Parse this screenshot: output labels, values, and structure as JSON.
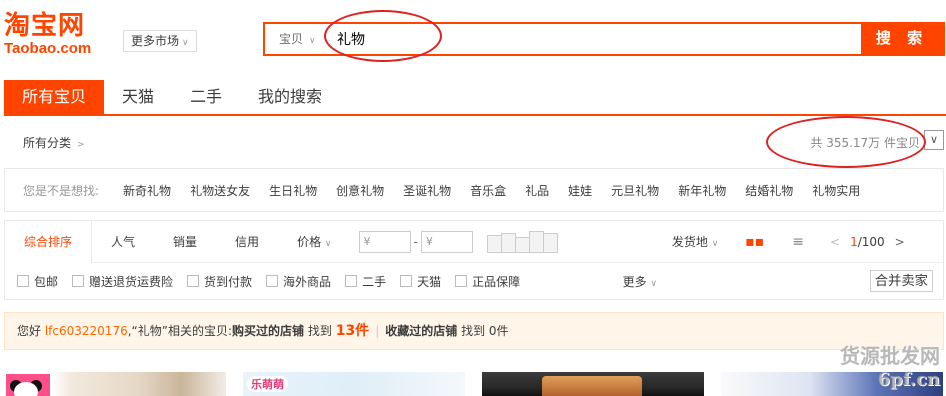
{
  "logo": {
    "cn": "淘宝网",
    "en": "Taobao.com"
  },
  "market_button": "更多市场",
  "search": {
    "type_label": "宝贝",
    "query": "礼物",
    "button": "搜 索"
  },
  "tabs": [
    "所有宝贝",
    "天猫",
    "二手",
    "我的搜索"
  ],
  "category": {
    "label": "所有分类",
    "count_text": "共 355.17万 件宝贝"
  },
  "suggest": {
    "label": "您是不是想找:",
    "items": [
      "新奇礼物",
      "礼物送女友",
      "生日礼物",
      "创意礼物",
      "圣诞礼物",
      "音乐盒",
      "礼品",
      "娃娃",
      "元旦礼物",
      "新年礼物",
      "结婚礼物",
      "礼物实用"
    ]
  },
  "sort": {
    "items": [
      "综合排序",
      "人气",
      "销量",
      "信用",
      "价格"
    ],
    "price_min_placeholder": "¥",
    "price_max_placeholder": "¥",
    "price_sep": "-",
    "location": "发货地",
    "page_current": "1",
    "page_total": "/100"
  },
  "checks": [
    "包邮",
    "赠送退货运费险",
    "货到付款",
    "海外商品",
    "二手",
    "天猫",
    "正品保障"
  ],
  "more_label": "更多",
  "merge_button": "合并卖家",
  "notice": {
    "greet": "您好",
    "user": "lfc603220176",
    "query_part": ",“礼物”相关的宝贝:",
    "bought_label": "购买过的店铺",
    "found1": "找到",
    "bought_count": "13件",
    "fav_label": "收藏过的店铺",
    "found2": "找到",
    "fav_count": "0件"
  },
  "thumbs": {
    "brand_tag": "乐萌萌"
  },
  "watermark": {
    "line1": "货源批发网",
    "line2": "6pf.cn"
  },
  "colors": {
    "accent": "#ff4400",
    "notice_bg": "#fff5e8",
    "annotation": "#dd2222"
  }
}
